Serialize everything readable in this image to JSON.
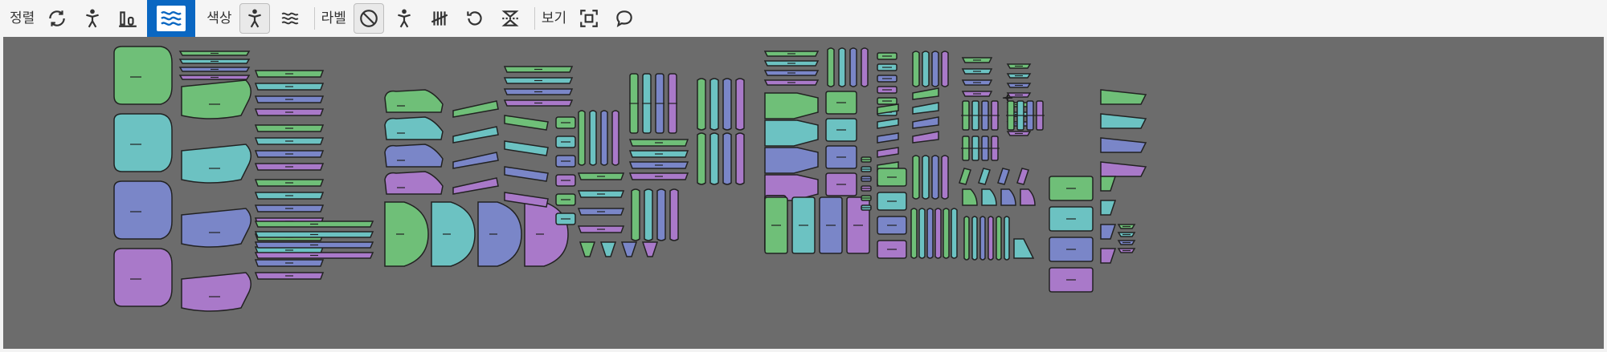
{
  "toolbar": {
    "sort_label": "정렬",
    "color_label": "색상",
    "label_label": "라벨",
    "view_label": "보기"
  },
  "icons": {
    "sort": [
      "rotate-icon",
      "person-icon",
      "bar-chart-icon",
      "waves-icon"
    ],
    "color": [
      "person-icon",
      "waves-icon"
    ],
    "label": [
      "no-label-icon",
      "person-icon",
      "tally-icon",
      "undo-icon",
      "flip-icon"
    ],
    "view": [
      "fit-view-icon",
      "speech-bubble-icon"
    ]
  },
  "colors": {
    "accent": "#0a67c2",
    "canvas": "#6c6c6c",
    "piece_green": "#6fbf78",
    "piece_teal": "#6cc2c2",
    "piece_blue": "#7a86c8",
    "piece_purple": "#a979c9"
  }
}
